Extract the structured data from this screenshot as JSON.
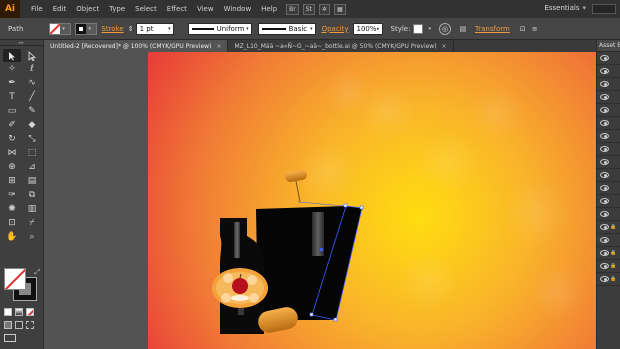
{
  "app": {
    "logo": "Ai"
  },
  "menubar": {
    "items": [
      "File",
      "Edit",
      "Object",
      "Type",
      "Select",
      "Effect",
      "View",
      "Window",
      "Help"
    ],
    "bridge_icon": "Br",
    "stock_icon": "St",
    "workspace": "Essentials"
  },
  "controlbar": {
    "selection_label": "Path",
    "stroke_label": "Stroke",
    "stroke_weight": "1 pt",
    "profile": "Uniform",
    "brush": "Basic",
    "opacity_label": "Opacity",
    "opacity_value": "100%",
    "style_label": "Style:",
    "transform_label": "Transform",
    "accent_color": "#f09a3e"
  },
  "tabs": [
    {
      "label": "Untitled-2 [Recovered]* @ 100% (CMYK/GPU Preview)",
      "active": true
    },
    {
      "label": "MZ_L10_Mää ~a«Ñ~G_~aä~_bottle.ai @ 50% (CMYK/GPU Preview)",
      "active": false
    }
  ],
  "right_panel": {
    "title": "Asset E",
    "rows": [
      {
        "icon": "eye-icon",
        "locked": false
      },
      {
        "icon": "eye-icon",
        "locked": false
      },
      {
        "icon": "eye-icon",
        "locked": false
      },
      {
        "icon": "eye-icon",
        "locked": false
      },
      {
        "icon": "eye-icon",
        "locked": false
      },
      {
        "icon": "eye-icon",
        "locked": false
      },
      {
        "icon": "eye-icon",
        "locked": false
      },
      {
        "icon": "eye-icon",
        "locked": false
      },
      {
        "icon": "eye-icon",
        "locked": false
      },
      {
        "icon": "eye-icon",
        "locked": false
      },
      {
        "icon": "eye-icon",
        "locked": false
      },
      {
        "icon": "eye-icon",
        "locked": false
      },
      {
        "icon": "eye-icon",
        "locked": false
      },
      {
        "icon": "eye-icon",
        "locked": true
      },
      {
        "icon": "eye-icon",
        "locked": false
      },
      {
        "icon": "eye-icon",
        "locked": true
      },
      {
        "icon": "eye-icon",
        "locked": true
      },
      {
        "icon": "eye-icon",
        "locked": true
      }
    ]
  },
  "tools": [
    "selection-tool-icon",
    "direct-selection-tool-icon",
    "magic-wand-tool-icon",
    "lasso-tool-icon",
    "pen-tool-icon",
    "curvature-tool-icon",
    "type-tool-icon",
    "line-segment-tool-icon",
    "rectangle-tool-icon",
    "paintbrush-tool-icon",
    "shaper-tool-icon",
    "eraser-tool-icon",
    "rotate-tool-icon",
    "scale-tool-icon",
    "width-tool-icon",
    "free-transform-tool-icon",
    "shape-builder-tool-icon",
    "perspective-grid-tool-icon",
    "mesh-tool-icon",
    "gradient-tool-icon",
    "eyedropper-tool-icon",
    "blend-tool-icon",
    "symbol-sprayer-tool-icon",
    "column-graph-tool-icon",
    "artboard-tool-icon",
    "slice-tool-icon",
    "hand-tool-icon",
    "zoom-tool-icon"
  ],
  "artwork": {
    "background_gradient": [
      "#ffd21a",
      "#f5a132",
      "#ea3c3c"
    ]
  }
}
